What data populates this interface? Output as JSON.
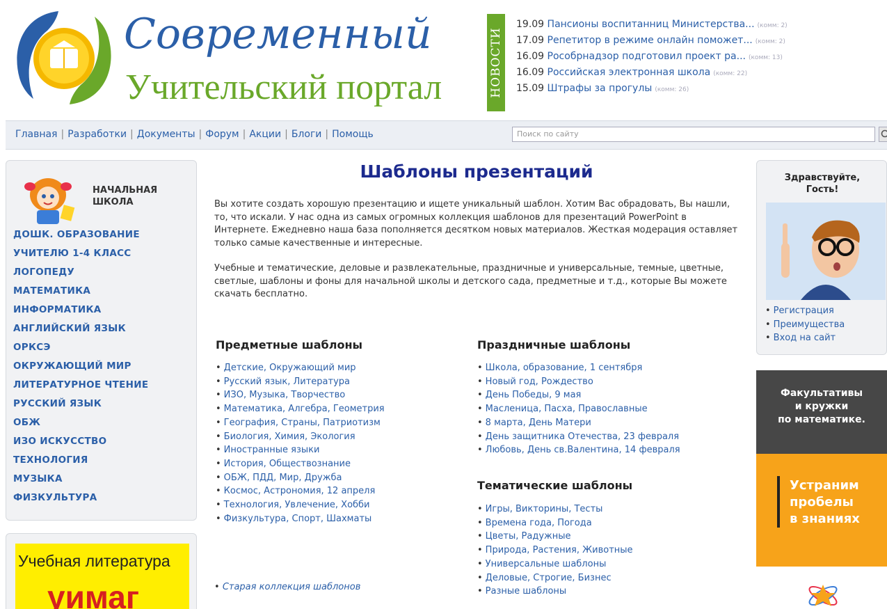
{
  "header": {
    "title_line1": "Современный",
    "title_line2": "Учительский портал",
    "news_label": "НОВОСТИ",
    "news": [
      {
        "date": "19.09",
        "text": "Пансионы воспитанниц Министерства...",
        "comments": "(комм: 2)"
      },
      {
        "date": "17.09",
        "text": "Репетитор в режиме онлайн поможет...",
        "comments": "(комм: 2)"
      },
      {
        "date": "16.09",
        "text": "Рособрнадзор подготовил проект ра...",
        "comments": "(комм: 13)"
      },
      {
        "date": "16.09",
        "text": "Российская электронная школа",
        "comments": "(комм: 22)"
      },
      {
        "date": "15.09",
        "text": "Штрафы за прогулы",
        "comments": "(комм: 26)"
      }
    ]
  },
  "nav": {
    "items": [
      "Главная",
      "Разработки",
      "Документы",
      "Форум",
      "Акции",
      "Блоги",
      "Помощь"
    ],
    "separator": "|",
    "search_placeholder": "Поиск по сайту"
  },
  "sidebar": {
    "title_line1": "НАЧАЛЬНАЯ",
    "title_line2": "ШКОЛА",
    "subjects": [
      "ДОШК. ОБРАЗОВАНИЕ",
      "УЧИТЕЛЮ 1-4 КЛАСС",
      "ЛОГОПЕДУ",
      "МАТЕМАТИКА",
      "ИНФОРМАТИКА",
      "АНГЛИЙСКИЙ ЯЗЫК",
      "ОРКСЭ",
      "ОКРУЖАЮЩИЙ МИР",
      "ЛИТЕРАТУРНОЕ ЧТЕНИЕ",
      "РУССКИЙ ЯЗЫК",
      "ОБЖ",
      "ИЗО ИСКУССТВО",
      "ТЕХНОЛОГИЯ",
      "МУЗЫКА",
      "ФИЗКУЛЬТУРА"
    ],
    "ad_line1": "Учебная литература",
    "ad_line2": "уимаг"
  },
  "main": {
    "title": "Шаблоны презентаций",
    "intro1": "Вы хотите создать хорошую презентацию и ищете уникальный шаблон. Хотим Вас обрадовать, Вы нашли, то, что искали. У нас одна из самых огромных коллекция шаблонов для презентаций PowerPoint в Интернете. Ежедневно наша база пополняется десятком новых материалов. Жесткая модерация оставляет только самые качественные и интересные.",
    "intro2": "Учебные и тематические, деловые и развлекательные, праздничные и универсальные, темные, цветные, светлые, шаблоны и фоны для начальной школы и детского сада, предметные и т.д., которые Вы можете скачать бесплатно.",
    "subject_heading": "Предметные шаблоны",
    "subject_items": [
      "Детские, Окружающий мир",
      "Русский язык, Литература",
      "ИЗО, Музыка, Творчество",
      "Математика, Алгебра, Геометрия",
      "География, Страны, Патриотизм",
      "Биология, Химия, Экология",
      "Иностранные языки",
      "История, Обществознание",
      "ОБЖ, ПДД, Мир, Дружба",
      "Космос, Астрономия, 12 апреля",
      "Технология, Увлечение, Хобби",
      "Физкультура, Спорт, Шахматы"
    ],
    "holiday_heading": "Праздничные шаблоны",
    "holiday_items": [
      "Школа, образование, 1 сентября",
      "Новый год, Рождество",
      "День Победы, 9 мая",
      "Масленица, Пасха, Православные",
      "8 марта, День Матери",
      "День защитника Отечества, 23 февраля",
      "Любовь, День св.Валентина, 14 февраля"
    ],
    "thematic_heading": "Тематические шаблоны",
    "thematic_items": [
      "Игры, Викторины, Тесты",
      "Времена года, Погода",
      "Цветы, Радужные",
      "Природа, Растения, Животные",
      "Универсальные шаблоны",
      "Деловые, Строгие, Бизнес",
      "Разные шаблоны"
    ],
    "old_collection": "Старая коллекция шаблонов"
  },
  "right": {
    "greeting_line1": "Здравствуйте,",
    "greeting_line2": "Гость!",
    "links": [
      "Регистрация",
      "Преимущества",
      "Вход на сайт"
    ],
    "promo1_line1": "Факультативы",
    "promo1_line2": "и кружки",
    "promo1_line3": "по математике.",
    "promo2_line1": "Устраним",
    "promo2_line2": "пробелы",
    "promo2_line3": "в знаниях"
  }
}
